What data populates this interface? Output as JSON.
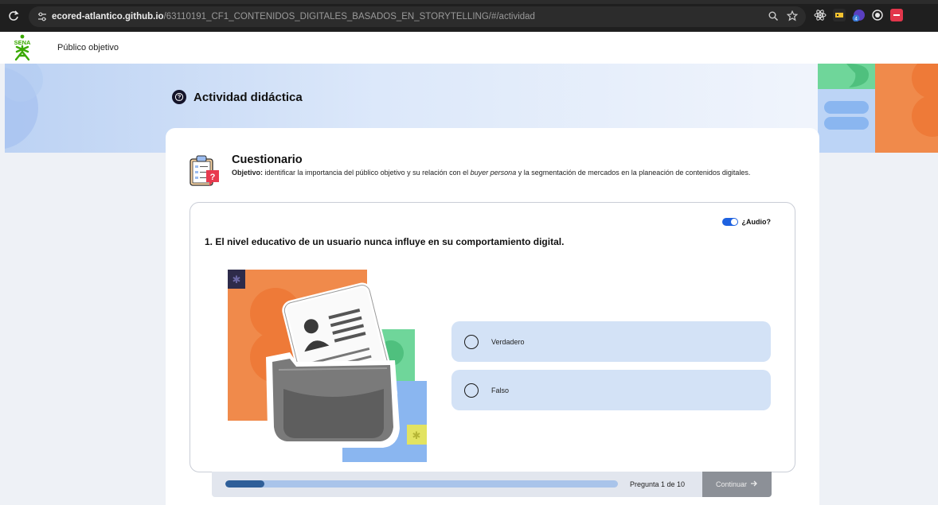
{
  "browser": {
    "url_host": "ecored-atlantico.github.io",
    "url_path": "/63110191_CF1_CONTENIDOS_DIGITALES_BASADOS_EN_STORYTELLING/#/actividad",
    "icons": [
      "reload-icon",
      "site-settings-icon",
      "zoom-icon",
      "bookmark-star-icon",
      "extension-icons"
    ],
    "extension_badge": "4"
  },
  "header": {
    "logo_text": "SENA",
    "title": "Público objetivo"
  },
  "banner": {
    "title": "Actividad didáctica",
    "icon": "question-circle-icon"
  },
  "quiz": {
    "title": "Cuestionario",
    "objective_label": "Objetivo:",
    "objective_text_1": " identificar la importancia del público objetivo y su relación con el ",
    "objective_italic": "buyer persona",
    "objective_text_2": " y la segmentación de mercados en la planeación de contenidos digitales.",
    "audio_label": "¿Audio?",
    "audio_enabled": true,
    "question": "1. El nivel educativo de un usuario nunca influye en su comportamiento digital.",
    "options": [
      {
        "label": "Verdadero",
        "selected": false
      },
      {
        "label": "Falso",
        "selected": false
      }
    ],
    "progress_fraction": 0.1,
    "page_label": "Pregunta 1 de 10",
    "continue_label": "Continuar",
    "continue_icon": "arrow-right-icon"
  },
  "colors": {
    "accent_blue": "#1e62e0",
    "option_bg": "#d3e2f6",
    "progress_fill": "#2f5f99",
    "progress_track": "#a9c4ea",
    "continue_bg": "#8c9097",
    "deco_orange": "#f08a4b",
    "deco_green": "#6fd69a",
    "deco_blue": "#8ab6f0"
  }
}
